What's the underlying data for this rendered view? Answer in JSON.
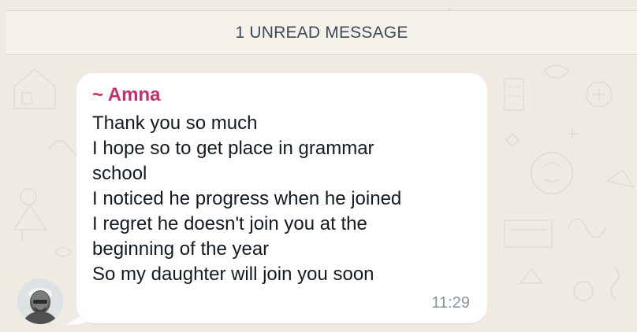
{
  "banner": {
    "text": "1 UNREAD MESSAGE"
  },
  "message": {
    "sender": "~ Amna",
    "lines": [
      "Thank you so much",
      "I hope so to get place in grammar",
      "school",
      "I noticed he progress when he joined",
      "I regret he doesn't join you at the",
      "beginning of the year",
      "So my daughter will join you soon"
    ],
    "time": "11:29"
  },
  "colors": {
    "wallpaper": "#efeae2",
    "bubble": "#ffffff",
    "sender": "#c4306e",
    "text": "#111b21",
    "timestamp": "#8696a0",
    "banner_text": "#3b4a54"
  },
  "icons": {
    "avatar": "person-avatar"
  }
}
